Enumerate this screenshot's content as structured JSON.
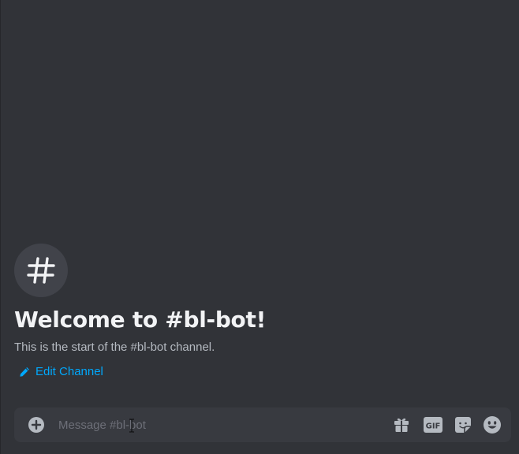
{
  "channel": {
    "name": "bl-bot",
    "avatar_glyph": "#"
  },
  "welcome": {
    "title": "Welcome to #bl-bot!",
    "subtitle": "This is the start of the #bl-bot channel.",
    "edit_label": "Edit Channel"
  },
  "composer": {
    "placeholder": "Message #bl-bot",
    "value": "",
    "gif_label": "GIF",
    "icons": [
      "plus-circle-icon",
      "gift-icon",
      "gif-icon",
      "sticker-icon",
      "emoji-icon"
    ]
  },
  "colors": {
    "background": "#313338",
    "composer": "#383a40",
    "link": "#00a8fc",
    "title": "#f2f3f5",
    "muted": "#b5bac1",
    "icon": "#b5bac1"
  }
}
